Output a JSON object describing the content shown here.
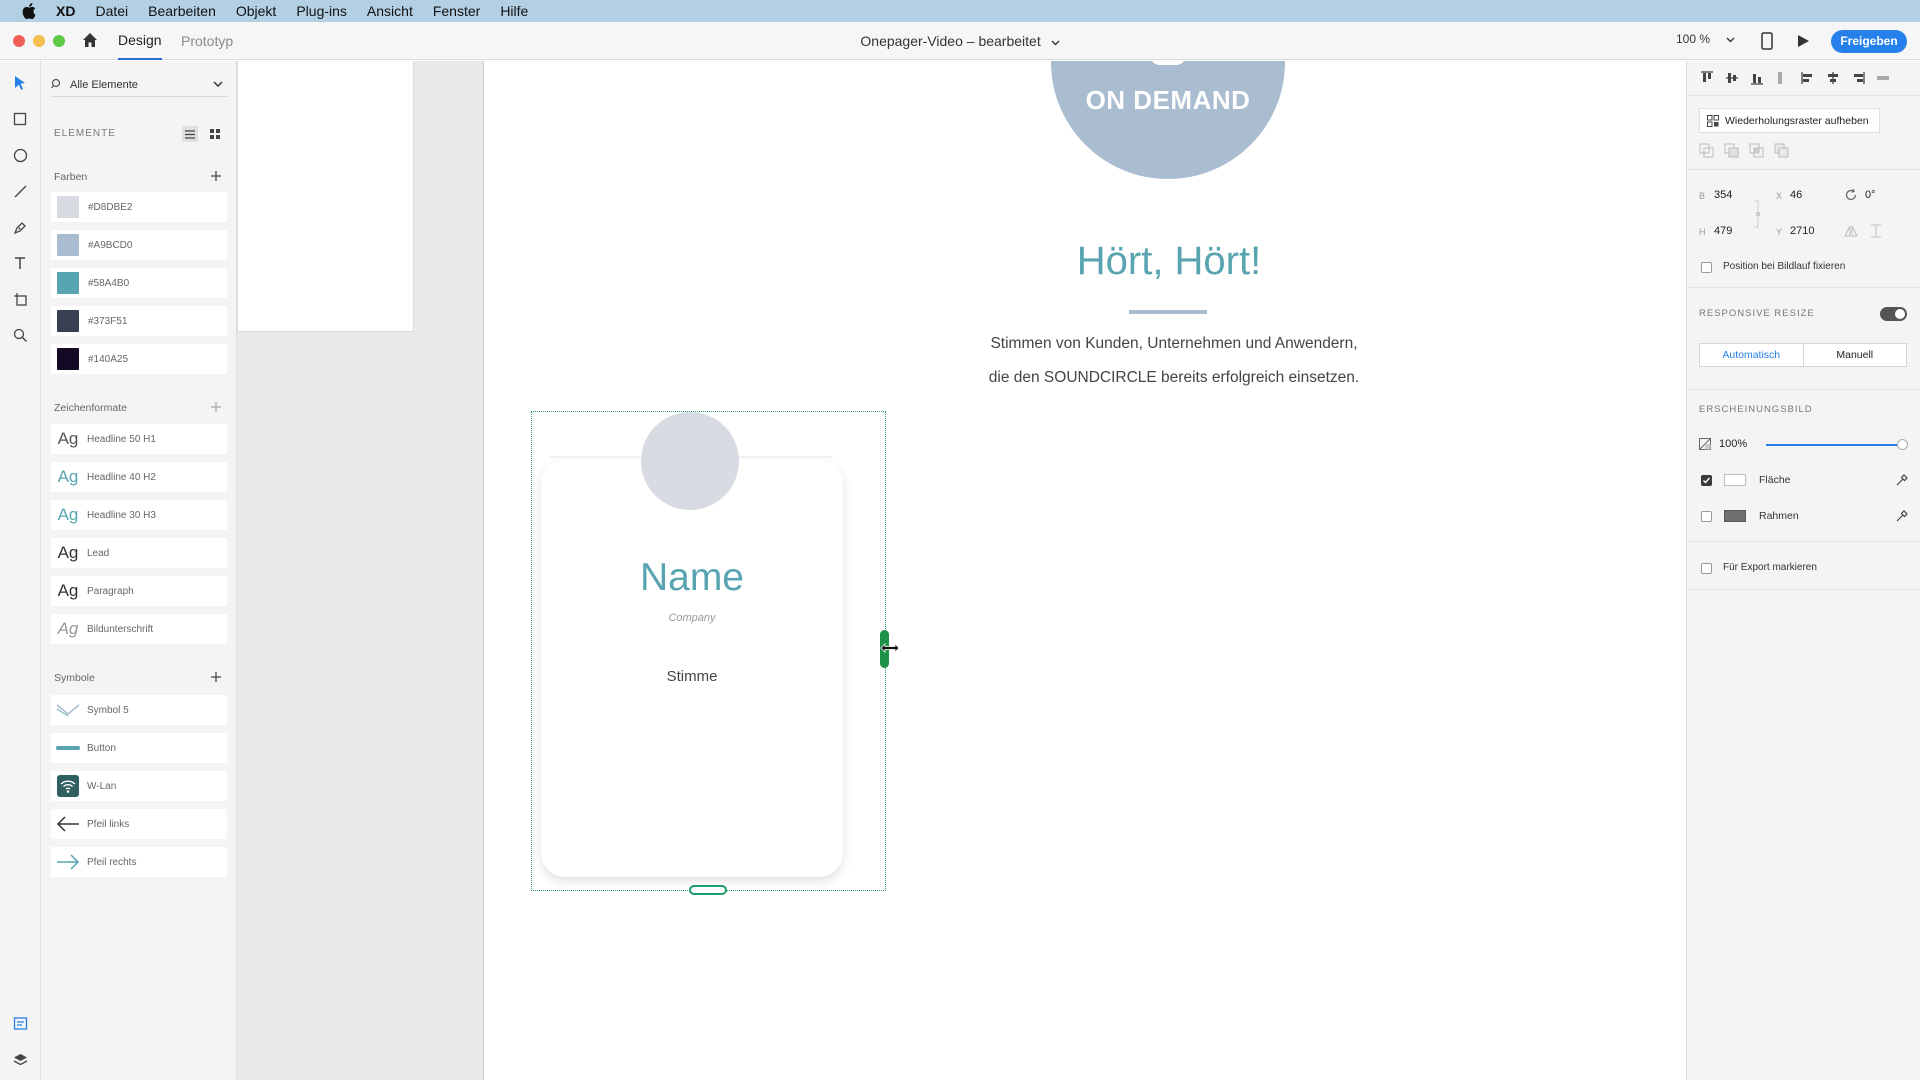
{
  "menubar": {
    "app": "XD",
    "items": [
      "Datei",
      "Bearbeiten",
      "Objekt",
      "Plug-ins",
      "Ansicht",
      "Fenster",
      "Hilfe"
    ]
  },
  "titlebar": {
    "tab_design": "Design",
    "tab_prototype": "Prototyp",
    "document_title": "Onepager-Video – bearbeitet",
    "zoom": "100 %",
    "share_label": "Freigeben"
  },
  "assets": {
    "filter_label": "Alle Elemente",
    "section_title": "ELEMENTE",
    "colors_label": "Farben",
    "colors": [
      {
        "hex": "#D8DBE2",
        "swatch": "#d8dbe2"
      },
      {
        "hex": "#A9BCD0",
        "swatch": "#a9bcd0"
      },
      {
        "hex": "#58A4B0",
        "swatch": "#58a4b0"
      },
      {
        "hex": "#373F51",
        "swatch": "#373f51"
      },
      {
        "hex": "#140A25",
        "swatch": "#140a25"
      }
    ],
    "char_styles_label": "Zeichenformate",
    "char_styles": [
      {
        "preview": "Ag",
        "name": "Headline 50 H1",
        "color": "#555555"
      },
      {
        "preview": "Ag",
        "name": "Headline 40 H2",
        "color": "#58a4b0"
      },
      {
        "preview": "Ag",
        "name": "Headline 30 H3",
        "color": "#58a4b0"
      },
      {
        "preview": "Ag",
        "name": "Lead",
        "color": "#333333"
      },
      {
        "preview": "Ag",
        "name": "Paragraph",
        "color": "#333333"
      },
      {
        "preview": "Ag",
        "name": "Bildunterschrift",
        "color": "#999999"
      }
    ],
    "symbols_label": "Symbole",
    "symbols": [
      {
        "name": "Symbol 5",
        "icon": "chevron-down-icon"
      },
      {
        "name": "Button",
        "icon": "button-bar-icon"
      },
      {
        "name": "W-Lan",
        "icon": "wifi-icon"
      },
      {
        "name": "Pfeil links",
        "icon": "arrow-left-icon"
      },
      {
        "name": "Pfeil rechts",
        "icon": "arrow-right-icon"
      }
    ]
  },
  "canvas": {
    "badge_text": "ON DEMAND",
    "headline": "Hört, Hört!",
    "lead_line1": "Stimmen von Kunden, Unternehmen und Anwendern,",
    "lead_line2": "die den SOUNDCIRCLE bereits erfolgreich einsetzen.",
    "card": {
      "name": "Name",
      "company": "Company",
      "voice": "Stimme"
    }
  },
  "inspector": {
    "repeat_grid_label": "Wiederholungsraster aufheben",
    "w_label": "B",
    "w_value": "354",
    "h_label": "H",
    "h_value": "479",
    "x_label": "X",
    "x_value": "46",
    "y_label": "Y",
    "y_value": "2710",
    "rotation": "0°",
    "fix_position_label": "Position bei Bildlauf fixieren",
    "responsive_label": "RESPONSIVE RESIZE",
    "auto_label": "Automatisch",
    "manual_label": "Manuell",
    "appearance_label": "ERSCHEINUNGSBILD",
    "opacity_value": "100%",
    "fill_label": "Fläche",
    "border_label": "Rahmen",
    "export_label": "Für Export markieren",
    "accent_color": "#2680eb"
  }
}
